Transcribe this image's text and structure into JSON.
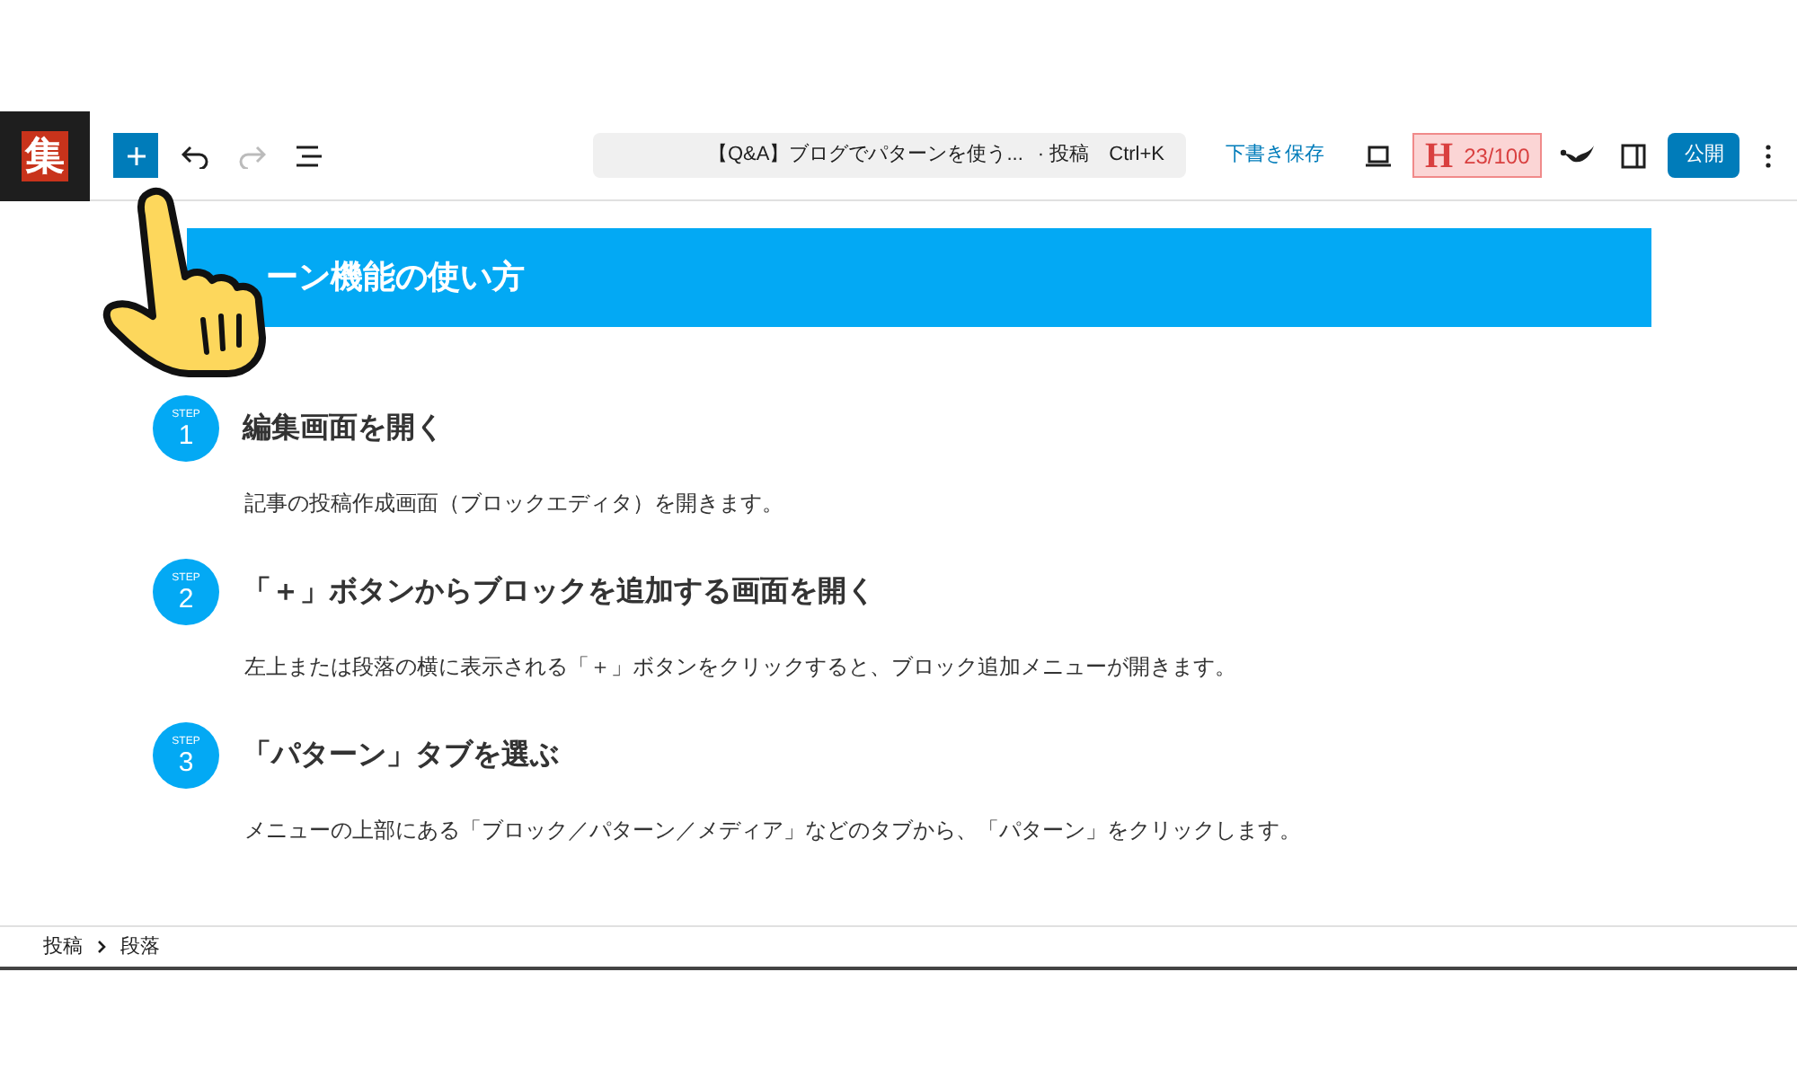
{
  "toolbar": {
    "logo": "集",
    "title": "【Q&A】ブログでパターンを使う...",
    "post_type": "· 投稿",
    "shortcut": "Ctrl+K",
    "save_draft": "下書き保存",
    "score": "23/100",
    "score_letter": "H",
    "publish": "公開"
  },
  "heading": "ーン機能の使い方",
  "steps": [
    {
      "label": "STEP",
      "number": "1",
      "title": "編集画面を開く",
      "text": "記事の投稿作成画面（ブロックエディタ）を開きます。"
    },
    {
      "label": "STEP",
      "number": "2",
      "title": "「＋」ボタンからブロックを追加する画面を開く",
      "text": "左上または段落の横に表示される「＋」ボタンをクリックすると、ブロック追加メニューが開きます。"
    },
    {
      "label": "STEP",
      "number": "3",
      "title": "「パターン」タブを選ぶ",
      "text": "メニューの上部にある「ブロック／パターン／メディア」などのタブから、「パターン」をクリックします。"
    }
  ],
  "breadcrumb": [
    "投稿",
    "段落"
  ]
}
